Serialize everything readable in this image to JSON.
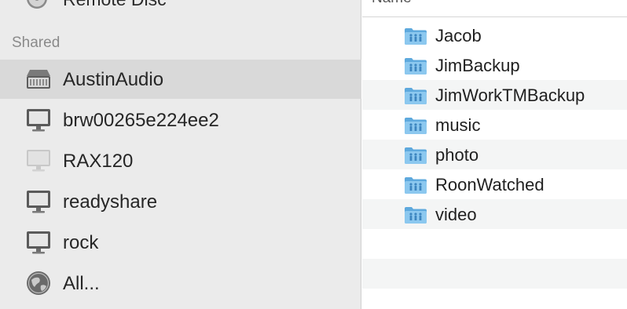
{
  "sidebar": {
    "partial_item": {
      "label": "Remote Disc",
      "icon": "disc-icon"
    },
    "section_title": "Shared",
    "items": [
      {
        "label": "AustinAudio",
        "icon": "nas-server-icon",
        "selected": true
      },
      {
        "label": "brw00265e224ee2",
        "icon": "display-icon"
      },
      {
        "label": "RAX120",
        "icon": "display-icon"
      },
      {
        "label": "readyshare",
        "icon": "display-icon"
      },
      {
        "label": "rock",
        "icon": "display-icon"
      },
      {
        "label": "All...",
        "icon": "network-globe-icon"
      }
    ]
  },
  "content": {
    "column_header": "Name",
    "files": [
      {
        "name": "Jacob",
        "icon": "shared-folder-icon"
      },
      {
        "name": "JimBackup",
        "icon": "shared-folder-icon"
      },
      {
        "name": "JimWorkTMBackup",
        "icon": "shared-folder-icon"
      },
      {
        "name": "music",
        "icon": "shared-folder-icon"
      },
      {
        "name": "photo",
        "icon": "shared-folder-icon"
      },
      {
        "name": "RoonWatched",
        "icon": "shared-folder-icon"
      },
      {
        "name": "video",
        "icon": "shared-folder-icon"
      }
    ]
  },
  "colors": {
    "sidebar_bg": "#ebebeb",
    "selection_bg": "#d9d9d9",
    "folder_blue": "#7fbfe9",
    "stripe": "#f4f5f5"
  }
}
